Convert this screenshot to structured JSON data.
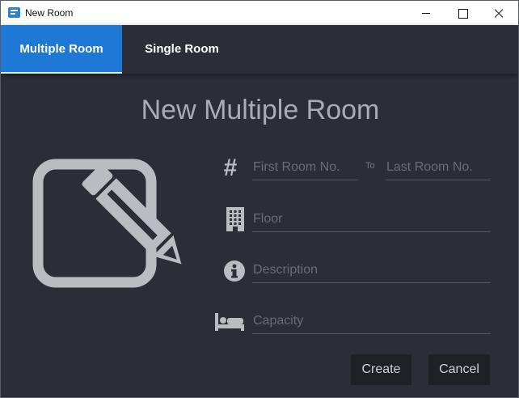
{
  "window": {
    "title": "New Room",
    "icons": {
      "app": "app-window-icon",
      "minimize": "minimize-icon",
      "maximize": "maximize-icon",
      "close": "close-icon"
    }
  },
  "tabs": [
    {
      "label": "Multiple Room",
      "active": true
    },
    {
      "label": "Single Room",
      "active": false
    }
  ],
  "colors": {
    "accent": "#1e78d6",
    "background": "#2b2e36",
    "icon": "#b9bcc1",
    "title": "#a9acb2",
    "button_bg": "#1f2127"
  },
  "form": {
    "title": "New Multiple Room",
    "illustration_icon": "edit-pencil-square-icon",
    "first_room": {
      "placeholder": "First Room No.",
      "value": "",
      "icon": "hash-icon"
    },
    "to_label": "To",
    "last_room": {
      "placeholder": "Last Room No.",
      "value": ""
    },
    "floor": {
      "placeholder": "Floor",
      "value": "",
      "icon": "building-icon"
    },
    "description": {
      "placeholder": "Description",
      "value": "",
      "icon": "info-circle-icon"
    },
    "capacity": {
      "placeholder": "Capacity",
      "value": "",
      "icon": "bed-icon"
    },
    "create_label": "Create",
    "cancel_label": "Cancel"
  }
}
